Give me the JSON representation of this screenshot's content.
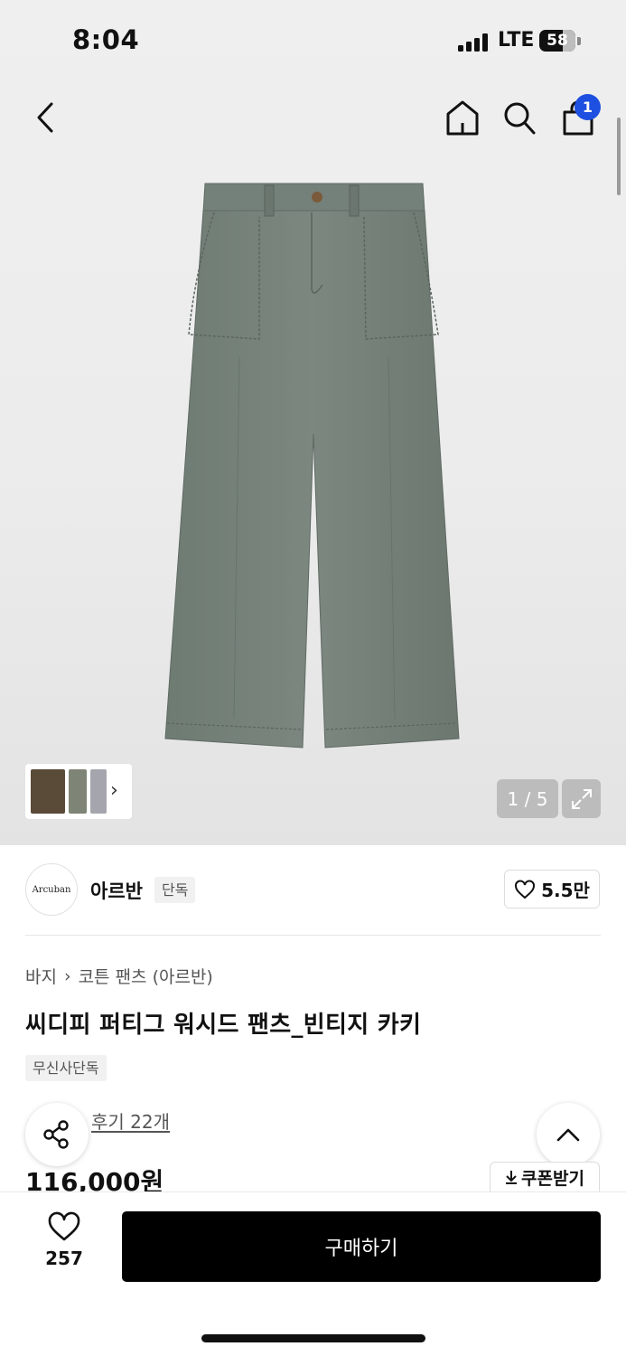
{
  "status_bar": {
    "time": "8:04",
    "network": "LTE",
    "battery": "58"
  },
  "nav": {
    "back_icon": "chevron-left-icon",
    "home_icon": "home-icon",
    "search_icon": "search-icon",
    "cart_icon": "shopping-bag-icon",
    "cart_count": "1"
  },
  "gallery": {
    "counter": "1 / 5",
    "thumb_arrow": "›",
    "expand_icon": "expand-icon"
  },
  "brand": {
    "logo_text": "Arcuban",
    "name": "아르반",
    "tag": "단독",
    "likes": "5.5만"
  },
  "product": {
    "breadcrumb": [
      "바지",
      "코튼 팬츠 (아르반)"
    ],
    "breadcrumb_separator": "›",
    "title": "씨디피 퍼티그 워시드 팬츠_빈티지 카키",
    "tag": "무신사단독",
    "review_link": "후기 22개",
    "price": "116,000원"
  },
  "actions": {
    "coupon_label": "쿠폰받기",
    "wish_count": "257",
    "buy_label": "구매하기"
  },
  "colors": {
    "accent_blue": "#1d4fe0",
    "pants_green": "#76837a",
    "buy_button": "#000000"
  }
}
